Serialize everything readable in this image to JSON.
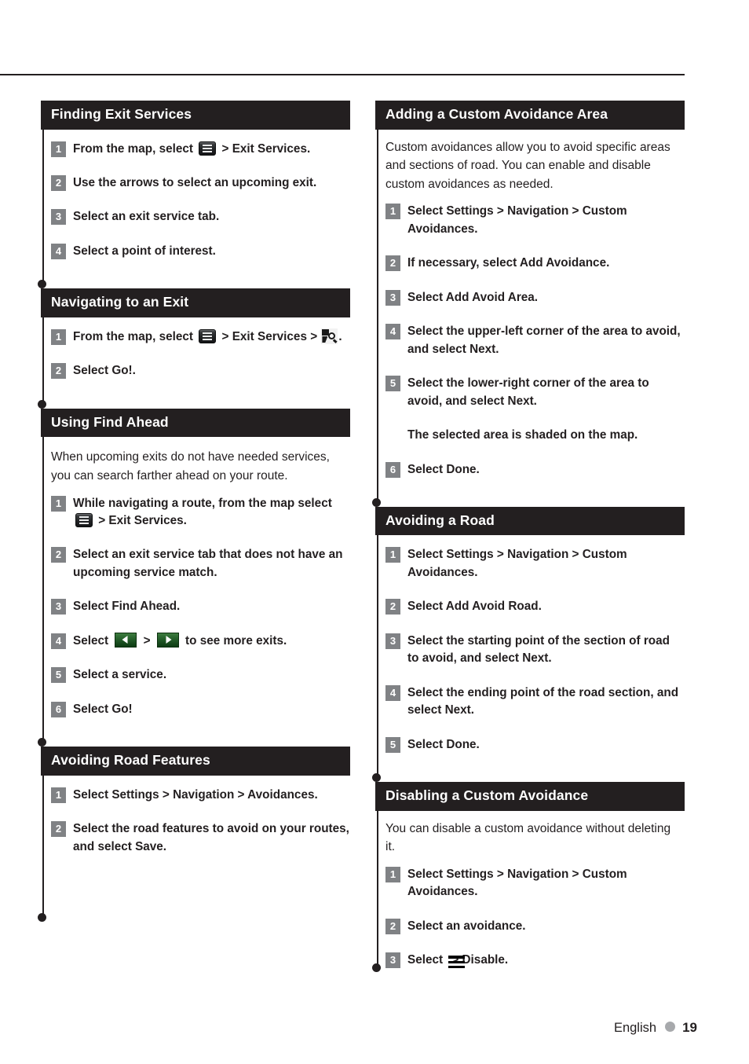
{
  "footer": {
    "language": "English",
    "page_number": "19",
    "dot_color": "#a7a9ac"
  },
  "colors": {
    "heading_bar": "#231f20",
    "step_badge": "#808285",
    "green_button": "#1d5a22",
    "text": "#231f20"
  },
  "left_column": [
    {
      "id": "finding-exit-services",
      "title": "Finding Exit Services",
      "intro": null,
      "steps": [
        {
          "num": "1",
          "pre": "From the map, select ",
          "icon": "menu-button-icon",
          "post": " > Exit Services."
        },
        {
          "num": "2",
          "pre": "Use the arrows to select an upcoming exit.",
          "icon": null,
          "post": ""
        },
        {
          "num": "3",
          "pre": "Select an exit service tab.",
          "icon": null,
          "post": ""
        },
        {
          "num": "4",
          "pre": "Select a point of interest.",
          "icon": null,
          "post": ""
        }
      ]
    },
    {
      "id": "navigating-to-an-exit",
      "title": "Navigating to an Exit",
      "intro": null,
      "steps": [
        {
          "num": "1",
          "pre": "From the map, select ",
          "icon": "menu-button-icon",
          "mid": " > Exit Services > ",
          "icon2": "find-poi-icon",
          "post": "."
        },
        {
          "num": "2",
          "pre": "Select Go!.",
          "icon": null,
          "post": ""
        }
      ]
    },
    {
      "id": "using-find-ahead",
      "title": "Using Find Ahead",
      "intro": "When upcoming exits do not have needed services, you can search farther ahead on your route.",
      "steps": [
        {
          "num": "1",
          "pre": "While navigating a route, from the map select ",
          "icon": "menu-button-icon",
          "post": " > Exit Services."
        },
        {
          "num": "2",
          "pre": "Select an exit service tab that does not have an upcoming service match.",
          "icon": null,
          "post": ""
        },
        {
          "num": "3",
          "pre": "Select Find Ahead.",
          "icon": null,
          "post": ""
        },
        {
          "num": "4",
          "pre": "Select ",
          "icon": "green-left-arrow-icon",
          "mid": " > ",
          "icon2": "green-right-arrow-icon",
          "post": " to see more exits."
        },
        {
          "num": "5",
          "pre": "Select a service.",
          "icon": null,
          "post": ""
        },
        {
          "num": "6",
          "pre": "Select Go!",
          "icon": null,
          "post": ""
        }
      ]
    },
    {
      "id": "avoiding-road-features",
      "title": "Avoiding Road Features",
      "intro": null,
      "steps": [
        {
          "num": "1",
          "pre": "Select Settings > Navigation > Avoidances.",
          "icon": null,
          "post": ""
        },
        {
          "num": "2",
          "pre": "Select the road features to avoid on your routes, and select Save.",
          "icon": null,
          "post": ""
        }
      ]
    }
  ],
  "right_column": [
    {
      "id": "adding-a-custom-avoidance-area",
      "title": "Adding a Custom Avoidance Area",
      "intro": "Custom avoidances allow you to avoid specific areas and sections of road. You can enable and disable custom avoidances as needed.",
      "steps": [
        {
          "num": "1",
          "pre": "Select Settings > Navigation > Custom Avoidances.",
          "icon": null,
          "post": ""
        },
        {
          "num": "2",
          "pre": "If necessary, select Add Avoidance.",
          "icon": null,
          "post": ""
        },
        {
          "num": "3",
          "pre": "Select Add Avoid Area.",
          "icon": null,
          "post": ""
        },
        {
          "num": "4",
          "pre": "Select the upper-left corner of the area to avoid, and select Next.",
          "icon": null,
          "post": ""
        },
        {
          "num": "5",
          "pre": "Select the lower-right corner of the area to avoid, and select Next.",
          "icon": null,
          "post": ""
        }
      ],
      "note": "The selected area is shaded on the map.",
      "steps_after_note": [
        {
          "num": "6",
          "pre": "Select Done.",
          "icon": null,
          "post": ""
        }
      ]
    },
    {
      "id": "avoiding-a-road",
      "title": "Avoiding a Road",
      "intro": null,
      "steps": [
        {
          "num": "1",
          "pre": "Select Settings > Navigation > Custom Avoidances.",
          "icon": null,
          "post": ""
        },
        {
          "num": "2",
          "pre": "Select Add Avoid Road.",
          "icon": null,
          "post": ""
        },
        {
          "num": "3",
          "pre": "Select the starting point of the section of road to avoid, and select Next.",
          "icon": null,
          "post": ""
        },
        {
          "num": "4",
          "pre": "Select the ending point of the road section, and select Next.",
          "icon": null,
          "post": ""
        },
        {
          "num": "5",
          "pre": "Select Done.",
          "icon": null,
          "post": ""
        }
      ]
    },
    {
      "id": "disabling-a-custom-avoidance",
      "title": "Disabling a Custom Avoidance",
      "intro": "You can disable a custom avoidance without deleting it.",
      "steps": [
        {
          "num": "1",
          "pre": "Select Settings > Navigation > Custom Avoidances.",
          "icon": null,
          "post": ""
        },
        {
          "num": "2",
          "pre": "Select an avoidance.",
          "icon": null,
          "post": ""
        },
        {
          "num": "3",
          "pre": "Select ",
          "icon": "hamburger-icon",
          "post": " > Disable."
        }
      ]
    }
  ]
}
